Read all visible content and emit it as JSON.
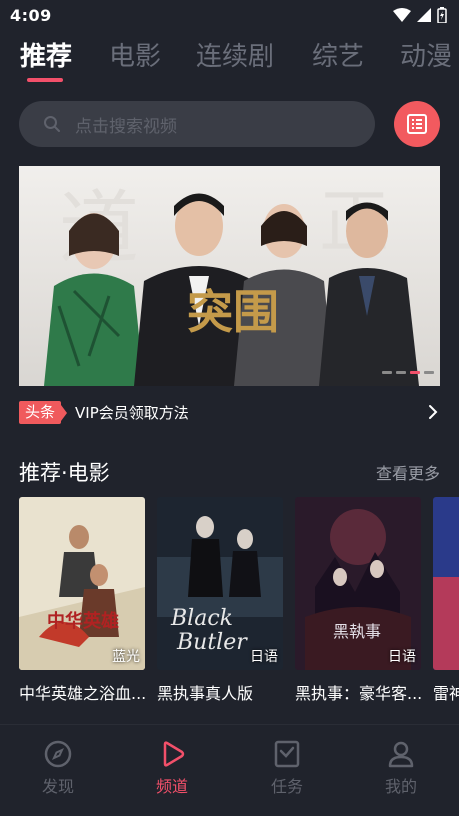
{
  "status_bar": {
    "time": "4:09",
    "icons": [
      "wifi-icon",
      "signal-icon",
      "battery-charging-icon"
    ]
  },
  "top_tabs": [
    {
      "label": "推荐",
      "active": true
    },
    {
      "label": "电影",
      "active": false
    },
    {
      "label": "连续剧",
      "active": false
    },
    {
      "label": "综艺",
      "active": false
    },
    {
      "label": "动漫",
      "active": false
    }
  ],
  "search": {
    "placeholder": "点击搜索视频",
    "icon": "search-icon"
  },
  "list_button": {
    "icon": "list-icon"
  },
  "banner": {
    "title_art": "突围",
    "slide_count": 4,
    "active_slide": 3
  },
  "headline": {
    "badge": "头条",
    "text": "VIP会员领取方法",
    "icon": "chevron-right-icon"
  },
  "section": {
    "title": "推荐·电影",
    "more_label": "查看更多"
  },
  "movies": [
    {
      "title": "中华英雄之浴血...",
      "tag": "蓝光",
      "poster_art": "中华英雄"
    },
    {
      "title": "黑执事真人版",
      "tag": "日语",
      "poster_art": "Black Butler"
    },
    {
      "title": "黑执事：豪华客...",
      "tag": "日语",
      "poster_art": "黑執事"
    },
    {
      "title": "雷神",
      "tag": "",
      "poster_art": ""
    }
  ],
  "bottom_nav": [
    {
      "label": "发现",
      "icon": "compass-icon",
      "active": false
    },
    {
      "label": "频道",
      "icon": "play-icon",
      "active": true
    },
    {
      "label": "任务",
      "icon": "task-icon",
      "active": false
    },
    {
      "label": "我的",
      "icon": "user-icon",
      "active": false
    }
  ],
  "colors": {
    "background": "#20232c",
    "accent": "#f2506a",
    "inactive": "#5f626c"
  }
}
